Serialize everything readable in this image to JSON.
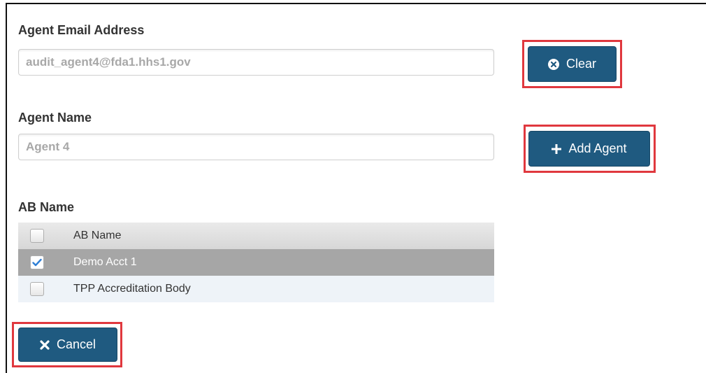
{
  "form": {
    "email_label": "Agent Email Address",
    "email_value": "audit_agent4@fda1.hhs1.gov",
    "name_label": "Agent Name",
    "name_value": "Agent 4",
    "ab_label": "AB Name"
  },
  "buttons": {
    "clear": "Clear",
    "add_agent": "Add Agent",
    "cancel": "Cancel"
  },
  "table": {
    "header": "AB Name",
    "rows": [
      {
        "name": "Demo Acct 1",
        "checked": true
      },
      {
        "name": "TPP Accreditation Body",
        "checked": false
      }
    ]
  },
  "icons": {
    "clear": "circle-x-icon",
    "add": "plus-icon",
    "cancel": "x-icon",
    "check": "checkmark-icon"
  },
  "colors": {
    "button_bg": "#1f5a80",
    "highlight": "#e0383e",
    "selected_row": "#a6a6a6",
    "checkmark": "#2f7fd6"
  }
}
